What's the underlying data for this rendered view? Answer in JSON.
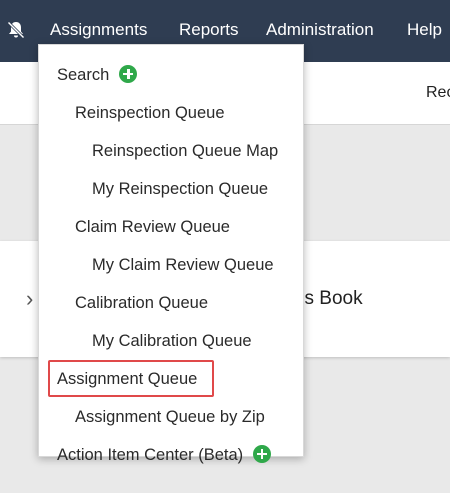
{
  "nav": {
    "items": [
      "Assignments",
      "Reports",
      "Administration",
      "Help"
    ]
  },
  "subbar": {
    "partial_text": "Rec"
  },
  "card": {
    "title_fragment": "ss Book"
  },
  "menu": {
    "items": [
      {
        "label": "Search",
        "has_add": true
      },
      {
        "label": "Reinspection Queue"
      },
      {
        "label": "Reinspection Queue Map"
      },
      {
        "label": "My Reinspection Queue"
      },
      {
        "label": "Claim Review Queue"
      },
      {
        "label": "My Claim Review Queue"
      },
      {
        "label": "Calibration Queue"
      },
      {
        "label": "My Calibration Queue"
      },
      {
        "label": "Assignment Queue",
        "highlighted": true
      },
      {
        "label": "Assignment Queue by Zip"
      },
      {
        "label": "Action Item Center (Beta)",
        "has_add": true
      }
    ]
  },
  "icons": {
    "notifications": "bell-muted-icon",
    "add": "plus-circle-icon",
    "expand": "chevron-right-icon"
  },
  "colors": {
    "topbar": "#2f3d52",
    "add_icon": "#2fa84a",
    "highlight_border": "#e0494a"
  }
}
